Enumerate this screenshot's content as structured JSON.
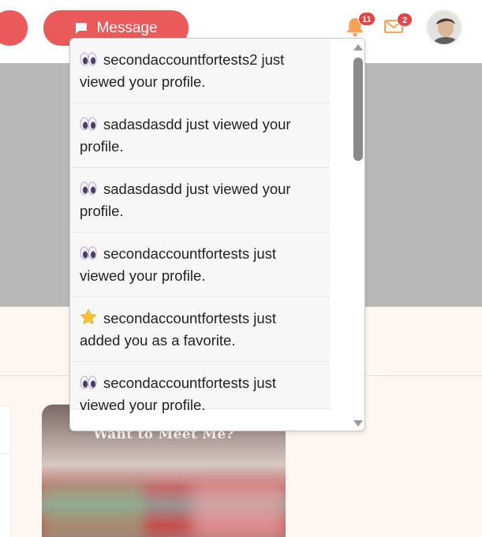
{
  "header": {
    "message_button_label": "Message",
    "bell_badge_count": "11",
    "mail_badge_count": "2",
    "accent_color": "#ea5a5b",
    "badge_color": "#e14546",
    "bell_color": "#f7a35c",
    "icons": [
      "message-icon",
      "bell-icon",
      "mail-icon",
      "avatar"
    ]
  },
  "notifications": [
    {
      "emoji": "eyes-icon",
      "text": "secondaccountfortests2 just viewed your profile."
    },
    {
      "emoji": "eyes-icon",
      "text": "sadasdasdd just viewed your profile."
    },
    {
      "emoji": "eyes-icon",
      "text": "sadasdasdd just viewed your profile."
    },
    {
      "emoji": "eyes-icon",
      "text": "secondaccountfortests just viewed your profile."
    },
    {
      "emoji": "star-icon",
      "text": "secondaccountfortests just added you as a favorite."
    },
    {
      "emoji": "eyes-icon",
      "text": "secondaccountfortests just viewed your profile."
    }
  ],
  "promo": {
    "title": "Want to Meet Me?"
  }
}
